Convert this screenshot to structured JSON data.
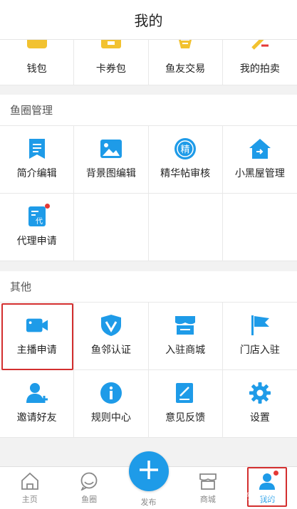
{
  "header": {
    "title": "我的"
  },
  "top_items": [
    {
      "label": "钱包",
      "icon": "wallet-icon"
    },
    {
      "label": "卡券包",
      "icon": "coupon-icon"
    },
    {
      "label": "鱼友交易",
      "icon": "trade-icon"
    },
    {
      "label": "我的拍卖",
      "icon": "auction-icon"
    }
  ],
  "section_manage": {
    "title": "鱼圈管理",
    "items": [
      {
        "label": "简介编辑",
        "icon": "document-icon"
      },
      {
        "label": "背景图编辑",
        "icon": "image-icon"
      },
      {
        "label": "精华帖审核",
        "icon": "essence-icon",
        "icon_text": "精"
      },
      {
        "label": "小黑屋管理",
        "icon": "house-icon"
      },
      {
        "label": "代理申请",
        "icon": "agent-doc-icon",
        "icon_text": "代"
      }
    ]
  },
  "section_other": {
    "title": "其他",
    "items": [
      {
        "label": "主播申请",
        "icon": "video-camera-icon"
      },
      {
        "label": "鱼邻认证",
        "icon": "verify-shield-icon"
      },
      {
        "label": "入驻商城",
        "icon": "store-icon"
      },
      {
        "label": "门店入驻",
        "icon": "flag-icon"
      },
      {
        "label": "邀请好友",
        "icon": "add-user-icon"
      },
      {
        "label": "规则中心",
        "icon": "info-icon"
      },
      {
        "label": "意见反馈",
        "icon": "feedback-icon"
      },
      {
        "label": "设置",
        "icon": "gear-icon"
      }
    ]
  },
  "tabbar": {
    "items": [
      {
        "label": "主页",
        "icon": "home-icon"
      },
      {
        "label": "鱼圈",
        "icon": "chat-icon"
      },
      {
        "label": "发布",
        "icon": "plus-icon"
      },
      {
        "label": "商城",
        "icon": "shop-icon"
      },
      {
        "label": "我的",
        "icon": "user-icon",
        "active": true
      }
    ]
  },
  "watermark": "知乎 @谢鹏",
  "colors": {
    "accent": "#1e9be8",
    "badge": "#e53935",
    "highlight": "#d32f2f",
    "icon_yellow": "#f2c230"
  }
}
